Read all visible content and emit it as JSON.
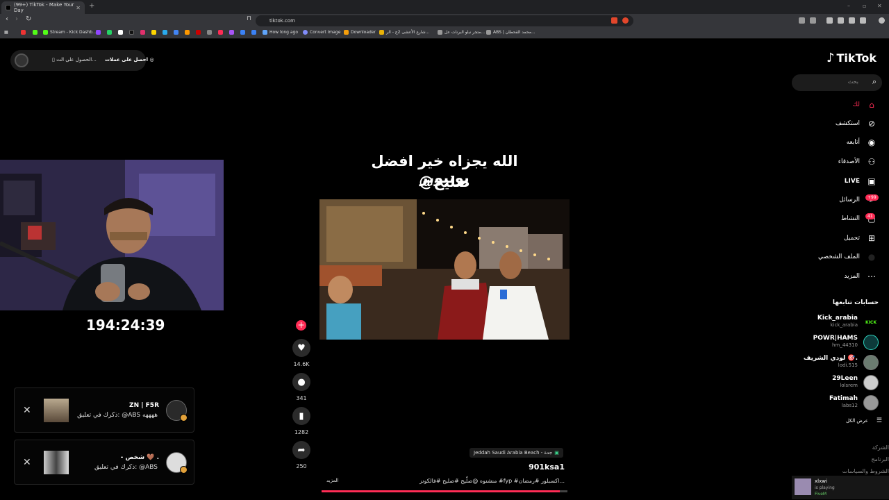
{
  "browser": {
    "tab_title": "(99+) TikTok - Make Your Day",
    "url": "tiktok.com",
    "bookmarks": [
      "Stream - Kick Dashb...",
      "How long ago",
      "Convert Image",
      "Downloader",
      "شارع الأعشى 2ج - الر...",
      "متجر نبلو البرنات عل...",
      "ABS | محمد القحطان..."
    ]
  },
  "overlay": {
    "alert_text": "احصل على عملات",
    "alert_text2": "الحصول على الت...",
    "timer": "194:24:39",
    "notifications": [
      {
        "name": "ZN | F5R",
        "message": "ذكرك في تعليق: @ABS ههههه"
      },
      {
        "name": "- شخص 🤎 .",
        "message": "ذكرك في تعليق: @ABS"
      }
    ]
  },
  "video": {
    "caption_line1": "الله يجزاه خير افضل يوتيوبر",
    "caption_line2": "@صليح",
    "likes": "14.6K",
    "comments": "341",
    "saves": "1282",
    "shares": "250",
    "location": "Jeddah Saudi Arabia Beach - جدة",
    "author": "901ksa1",
    "description": "منشنوه @صلّيح #صليح #فالكونز #fyp #اكسبلور #رمضان...",
    "more_label": "المزيد",
    "progress": 0.97
  },
  "sidebar": {
    "logo_text": "TikTok",
    "search_placeholder": "بحث",
    "nav": [
      {
        "label": "لك",
        "icon": "home"
      },
      {
        "label": "استكشف",
        "icon": "compass"
      },
      {
        "label": "أتابعه",
        "icon": "following"
      },
      {
        "label": "الأصدقاء",
        "icon": "friends"
      },
      {
        "label": "LIVE",
        "icon": "live"
      },
      {
        "label": "الرسائل",
        "icon": "messages",
        "badge": "+99"
      },
      {
        "label": "النشاط",
        "icon": "activity",
        "badge": "41"
      },
      {
        "label": "تحميل",
        "icon": "upload"
      },
      {
        "label": "الملف الشخصي",
        "icon": "profile"
      },
      {
        "label": "المزيد",
        "icon": "more"
      }
    ],
    "following_title": "حسابات تتابعها",
    "following": [
      {
        "name": "Kick_arabia",
        "handle": "kick_arabia"
      },
      {
        "name": "POWR|HAMS",
        "handle": "hm_44310"
      },
      {
        "name": "لودي الشريف 🎯.",
        "handle": "lodi.515"
      },
      {
        "name": "29Leen",
        "handle": "lolsrem"
      },
      {
        "name": "Fatimah",
        "handle": "labs12"
      }
    ],
    "see_all": "عرض الكل",
    "footer": [
      "الشركة",
      "البرنامج",
      "الشروط والسياسات"
    ],
    "player": {
      "title": "xlxwi",
      "status": "is playing",
      "app": "FiveM"
    }
  }
}
